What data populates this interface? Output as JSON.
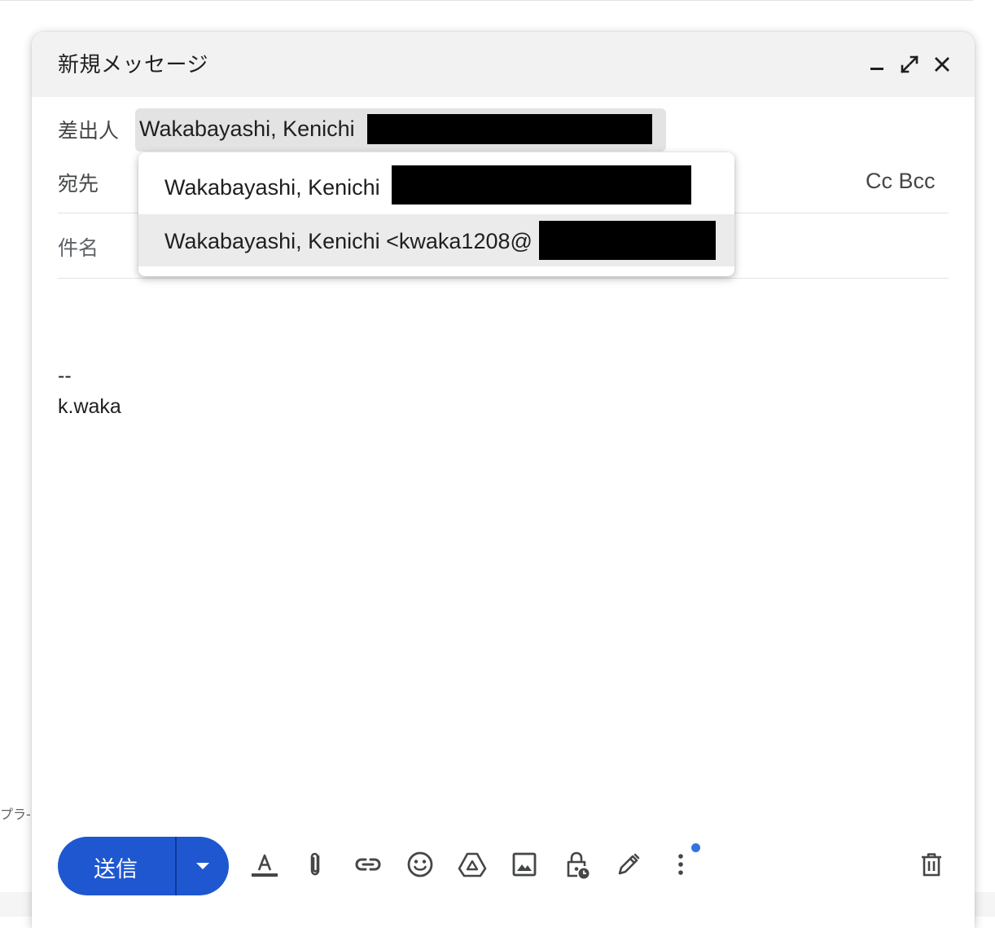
{
  "background": {
    "partial_text": "プラ-"
  },
  "compose": {
    "title": "新規メッセージ",
    "header_icons": [
      "minimize-icon",
      "fullscreen-icon",
      "close-icon"
    ],
    "from": {
      "label": "差出人",
      "value": "Wakabayashi, Kenichi"
    },
    "to": {
      "label": "宛先",
      "cc_bcc": "Cc Bcc"
    },
    "subject": {
      "placeholder": "件名"
    },
    "from_dropdown": {
      "options": [
        {
          "text": "Wakabayashi, Kenichi"
        },
        {
          "text": "Wakabayashi, Kenichi <kwaka1208@"
        }
      ]
    },
    "body": {
      "signature_separator": "--",
      "signature_name": "k.waka"
    },
    "toolbar": {
      "send_label": "送信",
      "icons": [
        "text-format-icon",
        "attach-icon",
        "link-icon",
        "emoji-icon",
        "drive-icon",
        "image-icon",
        "confidential-lock-icon",
        "signature-pen-icon",
        "more-options-icon",
        "delete-icon"
      ]
    },
    "colors": {
      "send_button": "#1f57d1",
      "header_bg": "#f2f2f2",
      "notify_dot": "#3474e0"
    }
  }
}
